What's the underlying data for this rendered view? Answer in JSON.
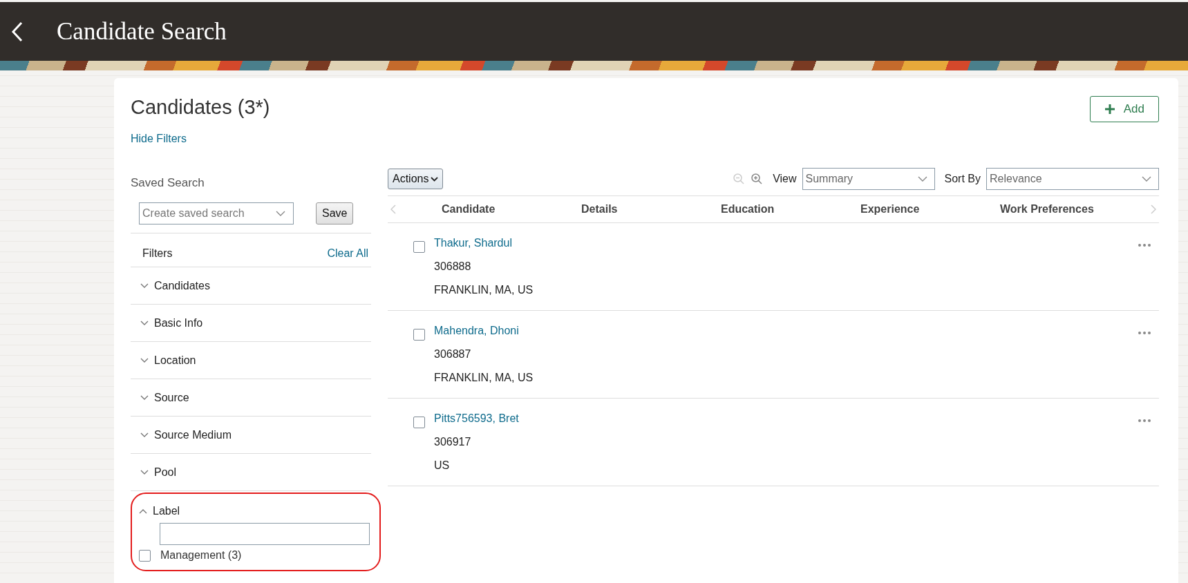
{
  "header": {
    "title": "Candidate Search"
  },
  "page": {
    "title": "Candidates (3*)",
    "hide_filters": "Hide Filters",
    "add_button": "Add"
  },
  "saved_search": {
    "label": "Saved Search",
    "placeholder": "Create saved search",
    "save": "Save"
  },
  "filters": {
    "title": "Filters",
    "clear_all": "Clear All",
    "items": [
      {
        "label": "Candidates",
        "expanded": false
      },
      {
        "label": "Basic Info",
        "expanded": false
      },
      {
        "label": "Location",
        "expanded": false
      },
      {
        "label": "Source",
        "expanded": false
      },
      {
        "label": "Source Medium",
        "expanded": false
      },
      {
        "label": "Pool",
        "expanded": false
      },
      {
        "label": "Label",
        "expanded": true,
        "options": [
          {
            "label": "Management (3)",
            "checked": false
          }
        ]
      }
    ]
  },
  "toolbar": {
    "actions": "Actions",
    "view_label": "View",
    "view_value": "Summary",
    "sort_label": "Sort By",
    "sort_value": "Relevance"
  },
  "table": {
    "columns": [
      "Candidate",
      "Details",
      "Education",
      "Experience",
      "Work Preferences"
    ],
    "rows": [
      {
        "name": "Thakur, Shardul",
        "id": "306888",
        "location": "FRANKLIN, MA, US",
        "selected": false
      },
      {
        "name": "Mahendra, Dhoni",
        "id": "306887",
        "location": "FRANKLIN, MA, US",
        "selected": false
      },
      {
        "name": "Pitts756593, Bret",
        "id": "306917",
        "location": "US",
        "selected": false
      }
    ]
  }
}
